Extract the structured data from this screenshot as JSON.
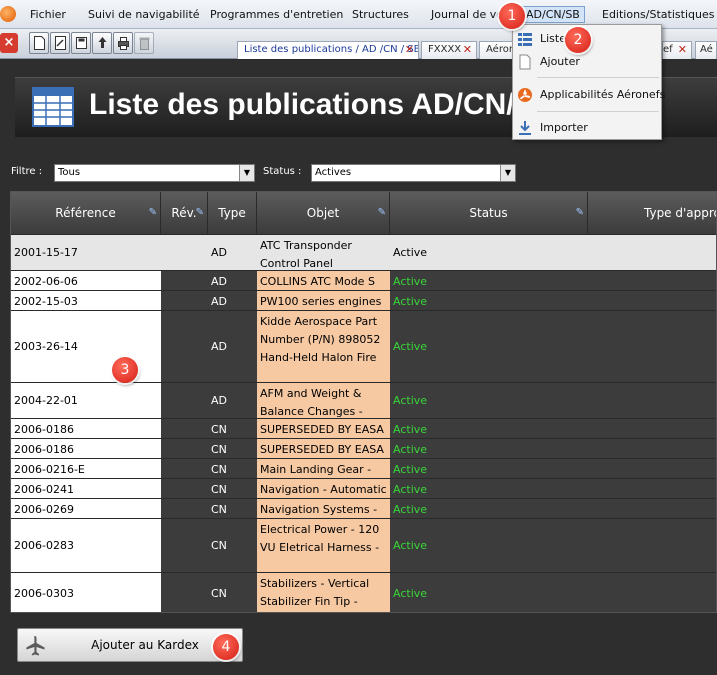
{
  "menubar": {
    "items": [
      "Fichier",
      "Suivi de navigabilité",
      "Programmes d'entretien",
      "Structures",
      "Journal de vol",
      "AD/CN/SB",
      "Editions/Statistiques"
    ]
  },
  "tabs": [
    "Liste des publications / AD /CN / SB",
    "FXXXX",
    "Aérone",
    "ef",
    "Aé"
  ],
  "dropdown": {
    "items": [
      "Liste",
      "Ajouter",
      "Applicabilités Aéronefs",
      "Importer"
    ]
  },
  "page": {
    "title": "Liste des publications AD/CN/SB"
  },
  "filters": {
    "filtre_label": "Filtre :",
    "filtre_value": "Tous",
    "status_label": "Status :",
    "status_value": "Actives"
  },
  "grid": {
    "columns": [
      "Référence",
      "Rév.",
      "Type",
      "Objet",
      "Status",
      "Type d'appro"
    ],
    "rows": [
      {
        "ref": "2001-15-17",
        "rev": "",
        "type": "AD",
        "objet": "ATC Transponder Control Panel",
        "status": "Active"
      },
      {
        "ref": "2002-06-06",
        "rev": "",
        "type": "AD",
        "objet": "COLLINS ATC Mode S",
        "status": "Active"
      },
      {
        "ref": "2002-15-03",
        "rev": "",
        "type": "AD",
        "objet": "PW100 series engines",
        "status": "Active"
      },
      {
        "ref": "2003-26-14",
        "rev": "",
        "type": "AD",
        "objet": "Kidde Aerospace Part Number (P/N) 898052 Hand-Held Halon Fire",
        "status": "Active"
      },
      {
        "ref": "2004-22-01",
        "rev": "",
        "type": "AD",
        "objet": "AFM and Weight & Balance Changes -",
        "status": "Active"
      },
      {
        "ref": "2006-0186",
        "rev": "",
        "type": "CN",
        "objet": "SUPERSEDED BY EASA",
        "status": "Active"
      },
      {
        "ref": "2006-0186",
        "rev": "",
        "type": "CN",
        "objet": "SUPERSEDED BY EASA",
        "status": "Active"
      },
      {
        "ref": "2006-0216-E",
        "rev": "",
        "type": "CN",
        "objet": "Main Landing Gear -",
        "status": "Active"
      },
      {
        "ref": "2006-0241",
        "rev": "",
        "type": "CN",
        "objet": "Navigation - Automatic",
        "status": "Active"
      },
      {
        "ref": "2006-0269",
        "rev": "",
        "type": "CN",
        "objet": "Navigation Systems -",
        "status": "Active"
      },
      {
        "ref": "2006-0283",
        "rev": "",
        "type": "CN",
        "objet": "Electrical Power - 120 VU Eletrical Harness -",
        "status": "Active"
      },
      {
        "ref": "2006-0303",
        "rev": "",
        "type": "CN",
        "objet": "Stabilizers - Vertical Stabilizer Fin Tip -",
        "status": "Active"
      }
    ]
  },
  "buttons": {
    "add_kardex": "Ajouter au Kardex"
  },
  "callouts": [
    "1",
    "2",
    "3",
    "4"
  ],
  "colors": {
    "status_active": "#37d637",
    "objet_bg": "#f6c9a3",
    "callout": "#d41d14",
    "menu_highlight": "#d3e4f8"
  }
}
